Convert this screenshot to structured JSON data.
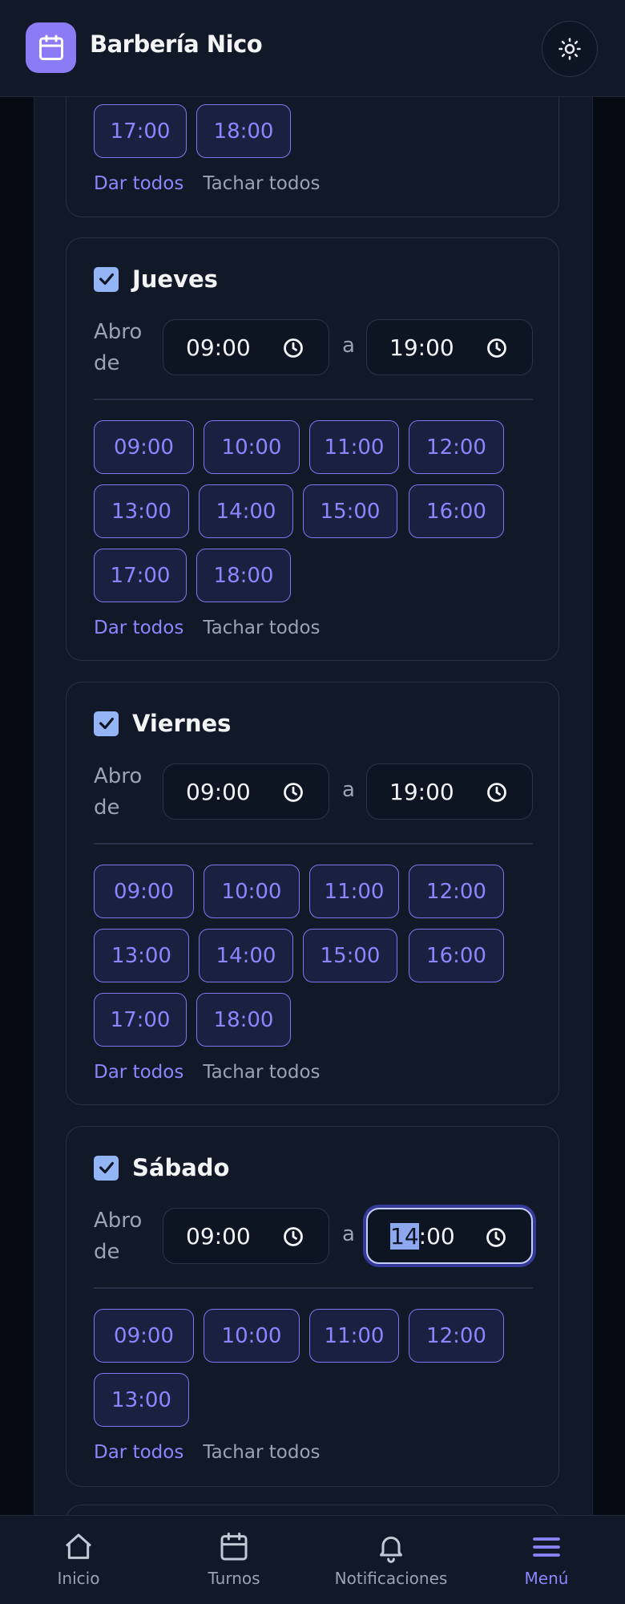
{
  "header": {
    "title": "Barbería Nico"
  },
  "top_partial": {
    "slots": [
      "17:00",
      "18:00"
    ],
    "select_all": "Dar todos",
    "clear_all": "Tachar todos"
  },
  "days": [
    {
      "name": "Jueves",
      "checked": true,
      "from_label": "Abro",
      "from_label2": "de",
      "open": "09:00",
      "sep": "a",
      "close": "19:00",
      "slots": [
        "09:00",
        "10:00",
        "11:00",
        "12:00",
        "13:00",
        "14:00",
        "15:00",
        "16:00",
        "17:00",
        "18:00"
      ],
      "select_all": "Dar todos",
      "clear_all": "Tachar todos"
    },
    {
      "name": "Viernes",
      "checked": true,
      "from_label": "Abro",
      "from_label2": "de",
      "open": "09:00",
      "sep": "a",
      "close": "19:00",
      "slots": [
        "09:00",
        "10:00",
        "11:00",
        "12:00",
        "13:00",
        "14:00",
        "15:00",
        "16:00",
        "17:00",
        "18:00"
      ],
      "select_all": "Dar todos",
      "clear_all": "Tachar todos"
    },
    {
      "name": "Sábado",
      "checked": true,
      "from_label": "Abro",
      "from_label2": "de",
      "open": "09:00",
      "sep": "a",
      "close_hour": "14",
      "close_min": ":00",
      "slots": [
        "09:00",
        "10:00",
        "11:00",
        "12:00",
        "13:00"
      ],
      "select_all": "Dar todos",
      "clear_all": "Tachar todos"
    }
  ],
  "nav": [
    {
      "label": "Inicio",
      "icon": "home-icon"
    },
    {
      "label": "Turnos",
      "icon": "calendar-icon"
    },
    {
      "label": "Notificaciones",
      "icon": "bell-icon"
    },
    {
      "label": "Menú",
      "icon": "menu-icon",
      "active": true
    }
  ],
  "colors": {
    "accent": "#8b86ff",
    "background": "#111827",
    "checkbox": "#93b4f5"
  }
}
